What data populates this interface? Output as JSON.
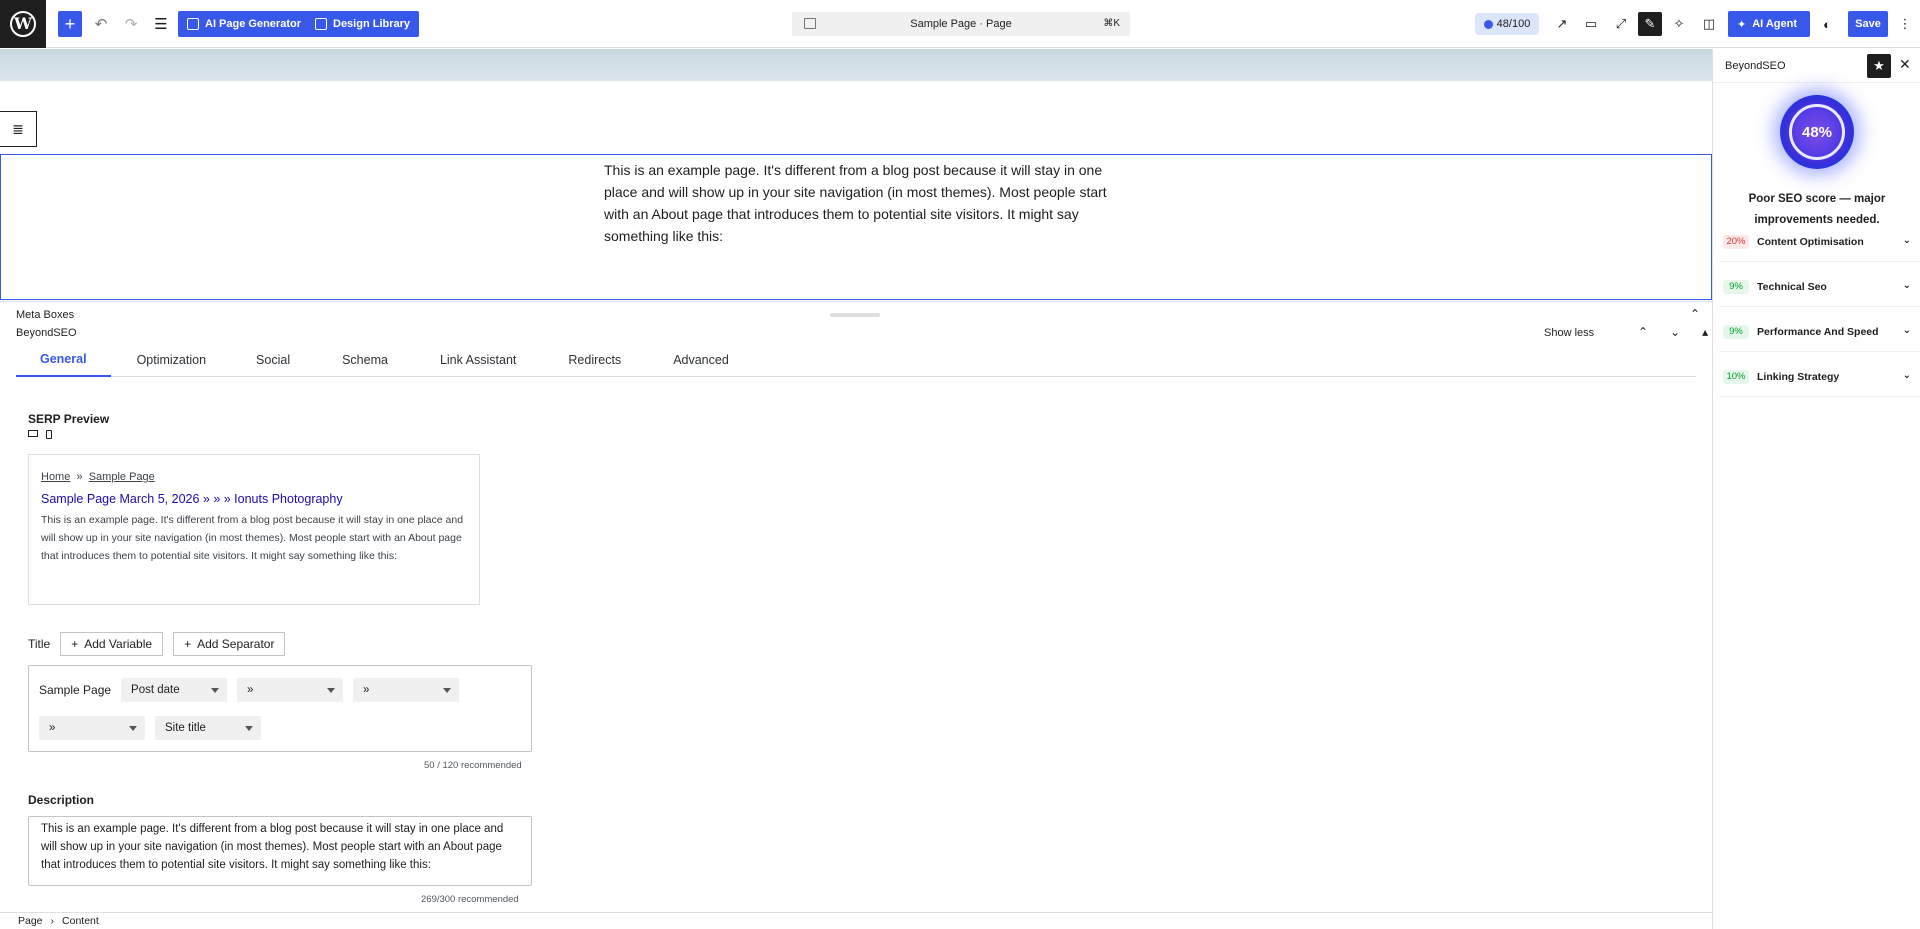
{
  "toolbar": {
    "ai_page_generator": "AI Page Generator",
    "design_library": "Design Library",
    "doc_title": "Sample Page · Page",
    "shortcut": "⌘K",
    "score": "48/100",
    "ai_agent": "AI Agent",
    "save": "Save"
  },
  "canvas": {
    "paragraph": "This is an example page. It's different from a blog post because it will stay in one place and will show up in your site navigation (in most themes). Most people start with an About page that introduces them to potential site visitors. It might say something like this:"
  },
  "meta": {
    "header_label": "Meta Boxes",
    "box_title": "BeyondSEO",
    "show_less": "Show less",
    "tabs": [
      {
        "label": "General"
      },
      {
        "label": "Optimization"
      },
      {
        "label": "Social"
      },
      {
        "label": "Schema"
      },
      {
        "label": "Link Assistant"
      },
      {
        "label": "Redirects"
      },
      {
        "label": "Advanced"
      }
    ],
    "serp": {
      "label": "SERP Preview",
      "crumb_home": "Home",
      "crumb_sep": "»",
      "crumb_page": "Sample Page",
      "title": "Sample Page March 5, 2026 » » » Ionuts Photography",
      "description": "This is an example page. It's different from a blog post because it will stay in one place and will show up in your site navigation (in most themes). Most people start with an About page that introduces them to potential site visitors. It might say something like this:"
    },
    "title_field": {
      "label": "Title",
      "add_variable": "Add Variable",
      "add_separator": "Add Separator",
      "static_text": "Sample Page",
      "tokens": [
        "Post date",
        "»",
        "»",
        "»",
        "Site title"
      ],
      "counter": "50 / 120 recommended"
    },
    "description_field": {
      "label": "Description",
      "value": "This is an example page. It's different from a blog post because it will stay in one place and will show up in your site navigation (in most themes). Most people start with an About page that introduces them to potential site visitors. It might say something like this:",
      "counter": "269/300 recommended"
    }
  },
  "footer": {
    "crumb1": "Page",
    "sep": "›",
    "crumb2": "Content"
  },
  "sidebar": {
    "title": "BeyondSEO",
    "score_percent": "48%",
    "score_message": "Poor SEO score — major improvements needed.",
    "items": [
      {
        "pct": "20%",
        "label": "Content Optimisation",
        "status": "red"
      },
      {
        "pct": "9%",
        "label": "Technical Seo",
        "status": "green"
      },
      {
        "pct": "9%",
        "label": "Performance And Speed",
        "status": "green"
      },
      {
        "pct": "10%",
        "label": "Linking Strategy",
        "status": "green"
      }
    ]
  },
  "colors": {
    "accent": "#3858e9",
    "dark": "#1e1e1e",
    "serp_link": "#1a0dab",
    "bad": "#d63638",
    "good": "#00a32a"
  }
}
